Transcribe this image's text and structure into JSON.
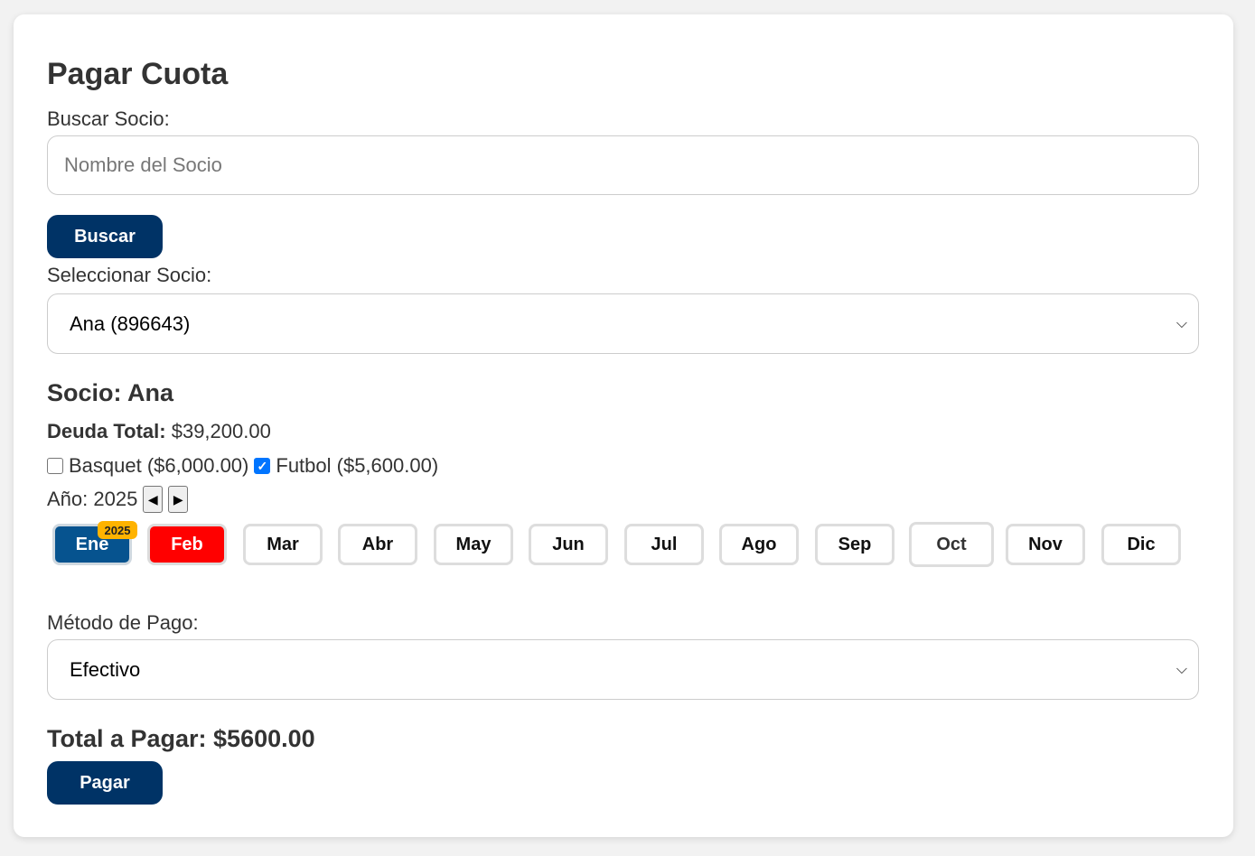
{
  "form": {
    "title": "Pagar Cuota",
    "search_label": "Buscar Socio:",
    "search_placeholder": "Nombre del Socio",
    "search_value": "",
    "search_button": "Buscar",
    "select_label": "Seleccionar Socio:",
    "selected_member": "Ana (896643)"
  },
  "member": {
    "heading": "Socio: Ana",
    "debt_label": "Deuda Total:",
    "debt_value": "$39,200.00",
    "activities": [
      {
        "label": "Basquet ($6,000.00)",
        "checked": false
      },
      {
        "label": "Futbol ($5,600.00)",
        "checked": true
      }
    ],
    "year_label": "Año: 2025",
    "prev_icon": "triangle-left-icon",
    "next_icon": "triangle-right-icon"
  },
  "months": [
    {
      "label": "Ene",
      "status": "paid",
      "badge": "2025"
    },
    {
      "label": "Feb",
      "status": "debt"
    },
    {
      "label": "Mar",
      "status": "none"
    },
    {
      "label": "Abr",
      "status": "none"
    },
    {
      "label": "May",
      "status": "none"
    },
    {
      "label": "Jun",
      "status": "none"
    },
    {
      "label": "Jul",
      "status": "none"
    },
    {
      "label": "Ago",
      "status": "none"
    },
    {
      "label": "Sep",
      "status": "none"
    },
    {
      "label": "Oct",
      "status": "none"
    },
    {
      "label": "Nov",
      "status": "none"
    },
    {
      "label": "Dic",
      "status": "none"
    }
  ],
  "payment": {
    "method_label": "Método de Pago:",
    "method_value": "Efectivo",
    "total_text": "Total a Pagar: $5600.00",
    "pay_button": "Pagar"
  },
  "colors": {
    "primary": "#003366",
    "paid_month": "#06538f",
    "debt_month": "#ff0000",
    "badge": "#ffb300",
    "checkbox_checked": "#0075ff"
  }
}
